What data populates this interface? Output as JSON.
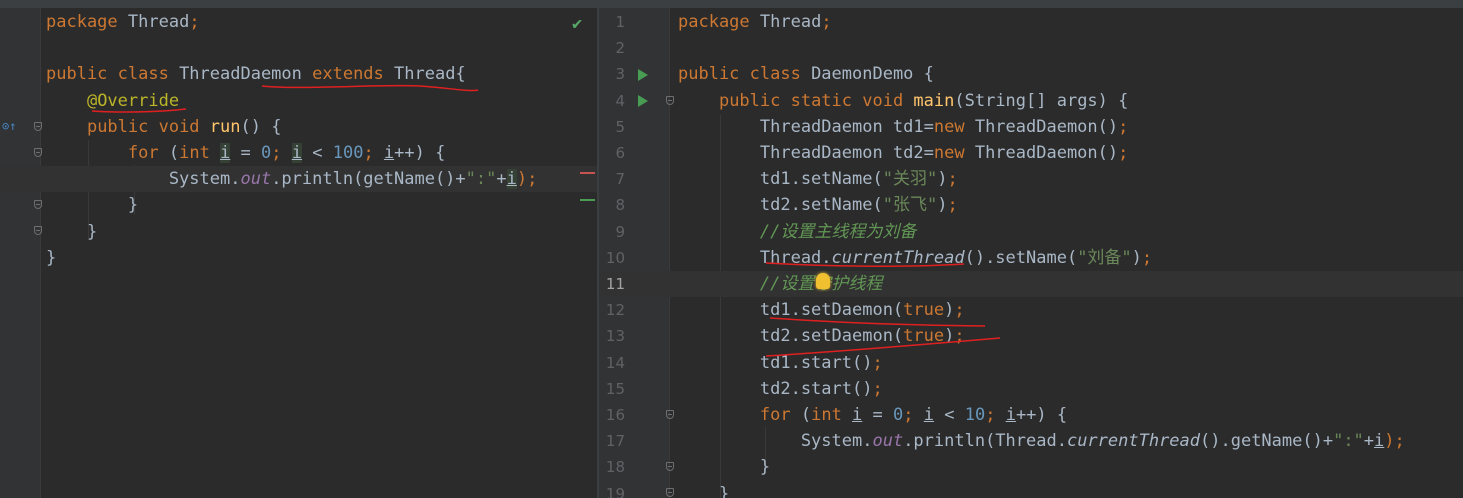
{
  "left_editor": {
    "lines": [
      [
        {
          "t": "package ",
          "c": "kw"
        },
        {
          "t": "Thread",
          "c": ""
        },
        {
          "t": ";",
          "c": "kw"
        }
      ],
      [],
      [
        {
          "t": "public class ",
          "c": "kw"
        },
        {
          "t": "ThreadDaemon ",
          "c": ""
        },
        {
          "t": "extends ",
          "c": "kw"
        },
        {
          "t": "Thread{",
          "c": ""
        }
      ],
      [
        {
          "t": "    ",
          "c": ""
        },
        {
          "t": "@Override",
          "c": "ann"
        }
      ],
      [
        {
          "t": "    ",
          "c": ""
        },
        {
          "t": "public void ",
          "c": "kw"
        },
        {
          "t": "run",
          "c": "fn"
        },
        {
          "t": "() {",
          "c": ""
        }
      ],
      [
        {
          "t": "        ",
          "c": ""
        },
        {
          "t": "for ",
          "c": "kw"
        },
        {
          "t": "(",
          "c": ""
        },
        {
          "t": "int ",
          "c": "kw"
        },
        {
          "t": "i",
          "c": "ivar"
        },
        {
          "t": " = ",
          "c": ""
        },
        {
          "t": "0",
          "c": "num"
        },
        {
          "t": "; ",
          "c": "kw"
        },
        {
          "t": "i",
          "c": "ivar"
        },
        {
          "t": " < ",
          "c": ""
        },
        {
          "t": "100",
          "c": "num"
        },
        {
          "t": "; ",
          "c": "kw"
        },
        {
          "t": "i",
          "c": "uvar"
        },
        {
          "t": "++) {",
          "c": ""
        }
      ],
      [
        {
          "t": "            System.",
          "c": ""
        },
        {
          "t": "out",
          "c": "fld"
        },
        {
          "t": ".println(getName()+",
          "c": ""
        },
        {
          "t": "\":\"",
          "c": "str"
        },
        {
          "t": "+",
          "c": ""
        },
        {
          "t": "i",
          "c": "ivar"
        },
        {
          "t": ");",
          "c": "kw"
        }
      ],
      [
        {
          "t": "        }",
          "c": ""
        }
      ],
      [
        {
          "t": "    }",
          "c": ""
        }
      ],
      [
        {
          "t": "}",
          "c": ""
        }
      ]
    ]
  },
  "right_editor": {
    "line_numbers": [
      "1",
      "2",
      "3",
      "4",
      "5",
      "6",
      "7",
      "8",
      "9",
      "10",
      "11",
      "12",
      "13",
      "14",
      "15",
      "16",
      "17",
      "18",
      "19"
    ],
    "current_line": "11",
    "lines": [
      [
        {
          "t": "package ",
          "c": "kw"
        },
        {
          "t": "Thread",
          "c": ""
        },
        {
          "t": ";",
          "c": "kw"
        }
      ],
      [],
      [
        {
          "t": "public class ",
          "c": "kw"
        },
        {
          "t": "DaemonDemo {",
          "c": ""
        }
      ],
      [
        {
          "t": "    ",
          "c": ""
        },
        {
          "t": "public static void ",
          "c": "kw"
        },
        {
          "t": "main",
          "c": "fn"
        },
        {
          "t": "(String[] args) {",
          "c": ""
        }
      ],
      [
        {
          "t": "        ThreadDaemon td1=",
          "c": ""
        },
        {
          "t": "new ",
          "c": "kw"
        },
        {
          "t": "ThreadDaemon()",
          "c": ""
        },
        {
          "t": ";",
          "c": "kw"
        }
      ],
      [
        {
          "t": "        ThreadDaemon td2=",
          "c": ""
        },
        {
          "t": "new ",
          "c": "kw"
        },
        {
          "t": "ThreadDaemon()",
          "c": ""
        },
        {
          "t": ";",
          "c": "kw"
        }
      ],
      [
        {
          "t": "        td1.setName(",
          "c": ""
        },
        {
          "t": "\"关羽\"",
          "c": "str"
        },
        {
          "t": ")",
          "c": ""
        },
        {
          "t": ";",
          "c": "kw"
        }
      ],
      [
        {
          "t": "        td2.setName(",
          "c": ""
        },
        {
          "t": "\"张飞\"",
          "c": "str"
        },
        {
          "t": ")",
          "c": ""
        },
        {
          "t": ";",
          "c": "kw"
        }
      ],
      [
        {
          "t": "        ",
          "c": ""
        },
        {
          "t": "//设置主线程为刘备",
          "c": "com"
        }
      ],
      [
        {
          "t": "        Thread.",
          "c": ""
        },
        {
          "t": "currentThread",
          "c": "ital"
        },
        {
          "t": "().setName(",
          "c": ""
        },
        {
          "t": "\"刘备\"",
          "c": "str"
        },
        {
          "t": ")",
          "c": ""
        },
        {
          "t": ";",
          "c": "kw"
        }
      ],
      [
        {
          "t": "        ",
          "c": ""
        },
        {
          "t": "//设置守护线程",
          "c": "com"
        }
      ],
      [
        {
          "t": "        td1.setDaemon(",
          "c": ""
        },
        {
          "t": "true",
          "c": "kw"
        },
        {
          "t": ")",
          "c": ""
        },
        {
          "t": ";",
          "c": "kw"
        }
      ],
      [
        {
          "t": "        td2.setDaemon(",
          "c": ""
        },
        {
          "t": "true",
          "c": "kw"
        },
        {
          "t": ")",
          "c": ""
        },
        {
          "t": ";",
          "c": "kw"
        }
      ],
      [
        {
          "t": "        td1.start()",
          "c": ""
        },
        {
          "t": ";",
          "c": "kw"
        }
      ],
      [
        {
          "t": "        td2.start()",
          "c": ""
        },
        {
          "t": ";",
          "c": "kw"
        }
      ],
      [
        {
          "t": "        ",
          "c": ""
        },
        {
          "t": "for ",
          "c": "kw"
        },
        {
          "t": "(",
          "c": ""
        },
        {
          "t": "int ",
          "c": "kw"
        },
        {
          "t": "i",
          "c": "uvar"
        },
        {
          "t": " = ",
          "c": ""
        },
        {
          "t": "0",
          "c": "num"
        },
        {
          "t": "; ",
          "c": "kw"
        },
        {
          "t": "i",
          "c": "uvar"
        },
        {
          "t": " < ",
          "c": ""
        },
        {
          "t": "10",
          "c": "num"
        },
        {
          "t": "; ",
          "c": "kw"
        },
        {
          "t": "i",
          "c": "uvar"
        },
        {
          "t": "++) {",
          "c": ""
        }
      ],
      [
        {
          "t": "            System.",
          "c": ""
        },
        {
          "t": "out",
          "c": "fld"
        },
        {
          "t": ".println(Thread.",
          "c": ""
        },
        {
          "t": "currentThread",
          "c": "ital"
        },
        {
          "t": "().getName()+",
          "c": ""
        },
        {
          "t": "\":\"",
          "c": "str"
        },
        {
          "t": "+",
          "c": ""
        },
        {
          "t": "i",
          "c": "uvar"
        },
        {
          "t": ");",
          "c": "kw"
        }
      ],
      [
        {
          "t": "        }",
          "c": ""
        }
      ],
      [
        {
          "t": "    }",
          "c": ""
        }
      ]
    ]
  },
  "icons": {
    "inspection_ok": "check-icon",
    "override": "override-icon",
    "run": "run-icon",
    "fold": "fold-icon",
    "intention": "bulb-icon"
  },
  "colors": {
    "editor_bg": "#2b2b2b",
    "gutter_bg": "#313335",
    "keyword": "#cc7832",
    "string": "#6a8759",
    "number": "#6897bb",
    "comment": "#629755",
    "annotation": "#bbb529",
    "method_decl": "#ffc66d",
    "field": "#9876aa",
    "ink_annotation": "#e02020"
  }
}
